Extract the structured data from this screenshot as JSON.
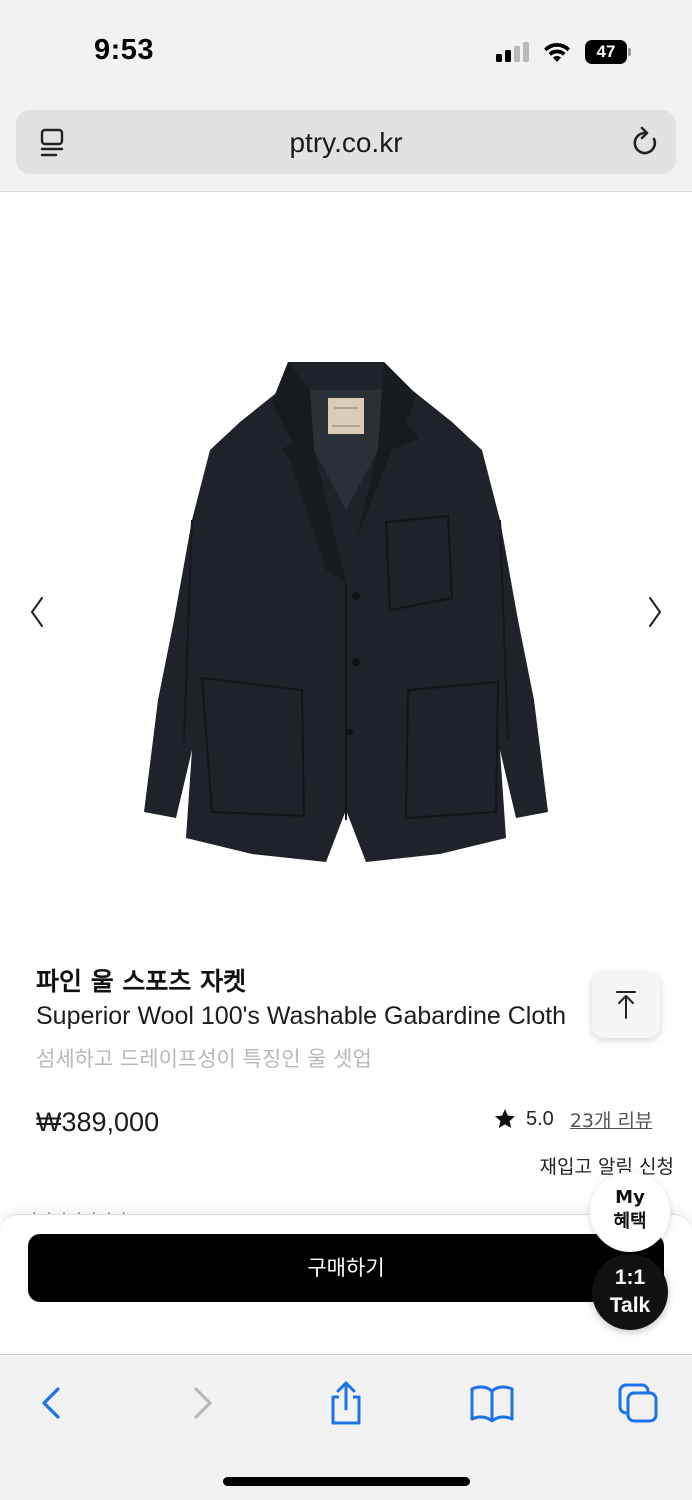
{
  "status_bar": {
    "time": "9:53",
    "battery_level": "47",
    "cellular_bars_active": 2,
    "cellular_bars_total": 4
  },
  "browser": {
    "url": "ptry.co.kr"
  },
  "product": {
    "title": "파인 울 스포츠 자켓",
    "subtitle": "Superior Wool 100's Washable Gabardine Cloth",
    "description": "섬세하고 드레이프성이 특징인 울 셋업",
    "price": "₩389,000",
    "rating": "5.0",
    "review_count": "23개 리뷰",
    "restock_alert": "재입고 알림 신청"
  },
  "purchase": {
    "buy_label": "구매하기",
    "peek_text": "· · · · · · ·"
  },
  "floating": {
    "my_benefit_line1": "My",
    "my_benefit_line2": "혜택",
    "talk_line1": "1:1",
    "talk_line2": "Talk"
  },
  "colors": {
    "accent_blue": "#1a73e8",
    "buy_button_bg": "#000000",
    "jacket": "#1f2329",
    "muted_text": "#b8b8b8"
  },
  "icons": {
    "reader": "reader-icon",
    "reload": "reload-icon",
    "prev": "chevron-left-icon",
    "next": "chevron-right-icon",
    "scroll_top": "arrow-up-icon",
    "back": "back-icon",
    "forward": "forward-icon",
    "share": "share-icon",
    "bookmarks": "bookmarks-icon",
    "tabs": "tabs-icon"
  }
}
